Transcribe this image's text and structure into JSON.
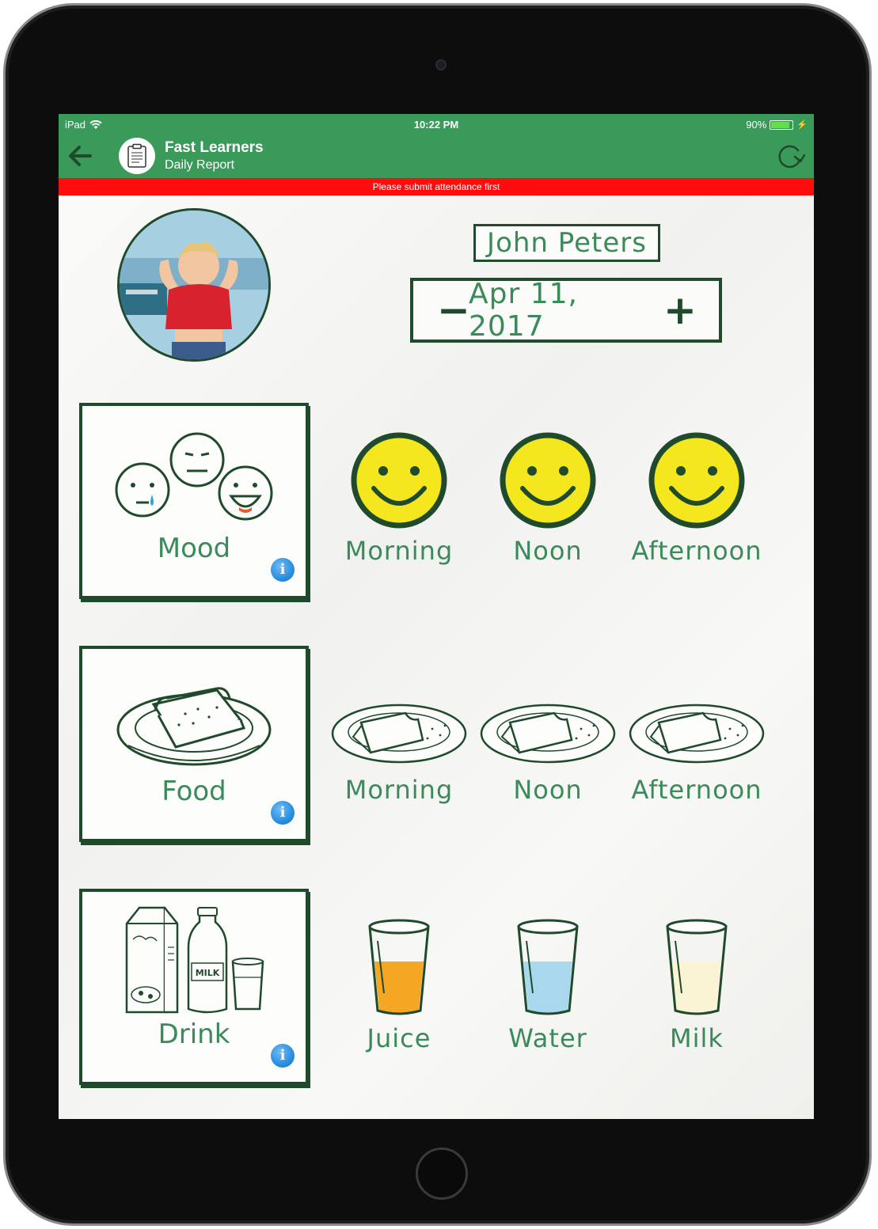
{
  "status_bar": {
    "device": "iPad",
    "time": "10:22 PM",
    "battery": "90%",
    "battery_level": 0.9
  },
  "nav": {
    "title": "Fast Learners",
    "subtitle": "Daily Report",
    "back_icon": "arrow-left-icon",
    "refresh_icon": "refresh-icon",
    "logo_icon": "clipboard-icon"
  },
  "warning": "Please submit attendance first",
  "child": {
    "name": "John Peters",
    "date": "Apr 11, 2017"
  },
  "date_controls": {
    "minus": "−",
    "plus": "+"
  },
  "categories": [
    {
      "label": "Mood",
      "icon": "mood-faces-icon",
      "options": [
        "Morning",
        "Noon",
        "Afternoon"
      ]
    },
    {
      "label": "Food",
      "icon": "sandwich-plate-icon",
      "options": [
        "Morning",
        "Noon",
        "Afternoon"
      ]
    },
    {
      "label": "Drink",
      "icon": "milk-carton-bottle-icon",
      "options": [
        "Juice",
        "Water",
        "Milk"
      ]
    }
  ],
  "info_glyph": "i",
  "colors": {
    "header_green": "#3a9a5a",
    "warning_red": "#ff0d0d",
    "text_green": "#3a8a5a",
    "outline_dark_green": "#1f4a2c",
    "smiley_yellow": "#f5e71e",
    "juice_orange": "#f5a623",
    "water_blue": "#a9d8ee",
    "milk_cream": "#faf4d4",
    "info_blue": "#2a8ee0"
  }
}
